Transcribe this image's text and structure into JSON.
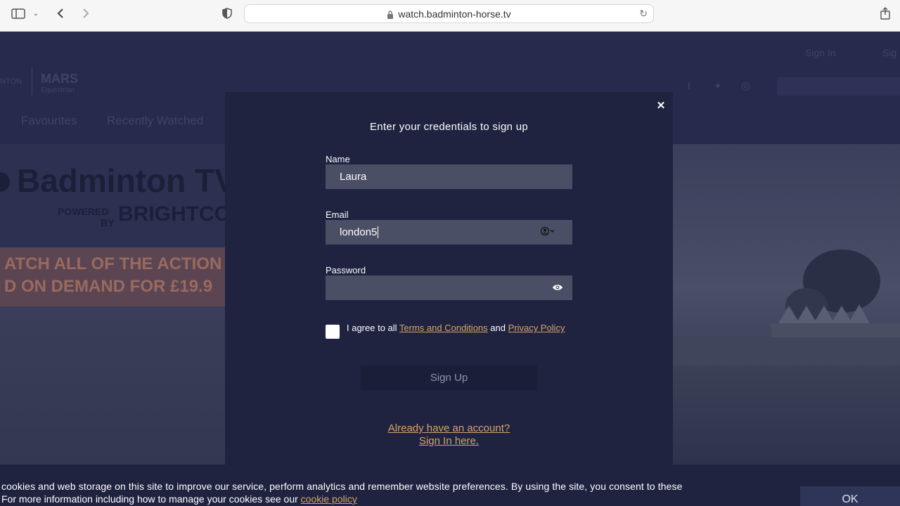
{
  "browser": {
    "url": "watch.badminton-horse.tv"
  },
  "site": {
    "header_link_signin": "Sign In",
    "header_link_signup": "Sig",
    "nav_items": [
      "Favourites",
      "Recently Watched"
    ],
    "logo_brand": "MARS",
    "logo_sub": "Equestrian",
    "logo_left": "NTON",
    "hero_title": "Badminton TV",
    "hero_powered": "POWERED",
    "hero_by": "BY",
    "hero_brightcove": "BRIGHTCOVE",
    "band_line1": "ATCH ALL OF THE ACTION",
    "band_line2": "D ON DEMAND FOR £19.9"
  },
  "modal": {
    "title": "Enter your credentials to sign up",
    "name_label": "Name",
    "name_value": "Laura",
    "email_label": "Email",
    "email_value": "london5",
    "password_label": "Password",
    "password_value": "",
    "agree_prefix": "I agree to all ",
    "terms_link": "Terms and Conditions",
    "agree_and": " and ",
    "privacy_link": "Privacy Policy",
    "signup_label": "Sign Up",
    "already_line1": "Already have an account?",
    "already_line2": "Sign In here."
  },
  "cookie": {
    "line1": "cookies and web storage on this site to improve our service, perform analytics and remember website preferences. By using the site, you consent to these",
    "line2_prefix": "For more information including how to manage your cookies see our ",
    "link": "cookie policy",
    "ok_label": "OK"
  },
  "icons": {
    "close": "close-icon",
    "eye": "eye-icon",
    "contact": "contact-autofill-icon"
  }
}
